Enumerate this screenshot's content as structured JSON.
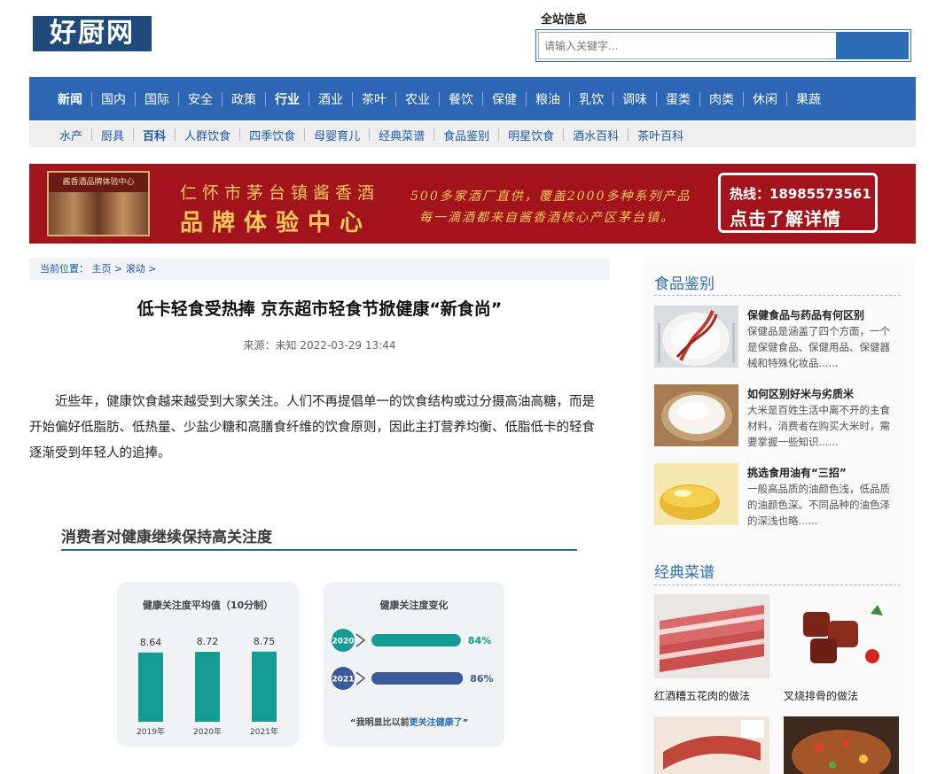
{
  "header": {
    "logo_text": "好厨网",
    "search_label": "全站信息",
    "search_placeholder": "请输入关键字..."
  },
  "nav_primary": [
    "新闻",
    "国内",
    "国际",
    "安全",
    "政策",
    "行业",
    "酒业",
    "茶叶",
    "农业",
    "餐饮",
    "保健",
    "粮油",
    "乳饮",
    "调味",
    "蛋类",
    "肉类",
    "休闲",
    "果蔬"
  ],
  "nav_secondary": [
    "水产",
    "厨具",
    "百科",
    "人群饮食",
    "四季饮食",
    "母婴育儿",
    "经典菜谱",
    "食品鉴别",
    "明星饮食",
    "酒水百科",
    "茶叶百科"
  ],
  "banner": {
    "store_sign": "酱香酒品牌体验中心",
    "line1": "仁怀市茅台镇酱香酒",
    "line2": "品牌体验中心",
    "sub1": "500多家酒厂直供，覆盖2000多种系列产品",
    "sub2": "每一滴酒都来自酱香酒核心产区茅台镇。",
    "hotline": "热线：18985573561",
    "cta": "点击了解详情"
  },
  "breadcrumb": {
    "label": "当前位置：",
    "home": "主页",
    "sep": ">",
    "section": "滚动"
  },
  "article": {
    "title": "低卡轻食受热捧 京东超市轻食节掀健康“新食尚”",
    "meta": "来源：未知 2022-03-29 13:44",
    "body": "近些年，健康饮食越来越受到大家关注。人们不再提倡单一的饮食结构或过分摄高油高糖，而是开始偏好低脂肪、低热量、少盐少糖和高膳食纤维的饮食原则，因此主打营养均衡、低脂低卡的轻食逐渐受到年轻人的追捧。"
  },
  "infographic": {
    "title": "消费者对健康继续保持高关注度",
    "left_card_title": "健康关注度平均值（10分制）",
    "right_card_title": "健康关注度变化",
    "quote_prefix": "“我明显比以前",
    "quote_highlight": "更关注健康了",
    "quote_suffix": "”"
  },
  "chart_data": [
    {
      "type": "bar",
      "title": "健康关注度平均值（10分制）",
      "categories": [
        "2019年",
        "2020年",
        "2021年"
      ],
      "values": [
        8.64,
        8.72,
        8.75
      ],
      "labels": [
        "8.64",
        "8.72",
        "8.75"
      ],
      "color": "#169b94"
    },
    {
      "type": "bar",
      "title": "健康关注度变化",
      "categories": [
        "2020",
        "2021"
      ],
      "values": [
        84,
        86
      ],
      "labels": [
        "84%",
        "86%"
      ],
      "colors": [
        "#169b94",
        "#3c5a9a"
      ]
    }
  ],
  "sidebar": {
    "section1_title": "食品鉴别",
    "items": [
      {
        "title": "保健食品与药品有何区别",
        "desc": "保健品是涵盖了四个方面，一个是保健食品、保健用品、保健器械和特殊化妆品......",
        "icon": "dna-plate-image"
      },
      {
        "title": "如何区别好米与劣质米",
        "desc": "大米是百姓生活中离不开的主食材料，消费者在购买大米时，需要掌握一些知识......",
        "icon": "rice-bowl-image"
      },
      {
        "title": "挑选食用油有“三招”",
        "desc": "一般高品质的油颜色浅，低品质的油颜色深。不同品种的油色泽的深浅也略......",
        "icon": "oil-glass-image"
      }
    ],
    "section2_title": "经典菜谱",
    "recipes": [
      {
        "label": "红酒糟五花肉的做法",
        "icon": "pork-belly-image"
      },
      {
        "label": "叉烧排骨的做法",
        "icon": "bbq-ribs-image"
      },
      {
        "label": "",
        "icon": "sausage-image"
      },
      {
        "label": "",
        "icon": "grilled-fish-image"
      }
    ]
  },
  "colors": {
    "brand_blue": "#2b65b3",
    "logo_blue": "#1f4a7a",
    "banner_red": "#a3131b",
    "banner_gold": "#f3c75a",
    "teal": "#169b94",
    "navy": "#3c5a9a"
  }
}
